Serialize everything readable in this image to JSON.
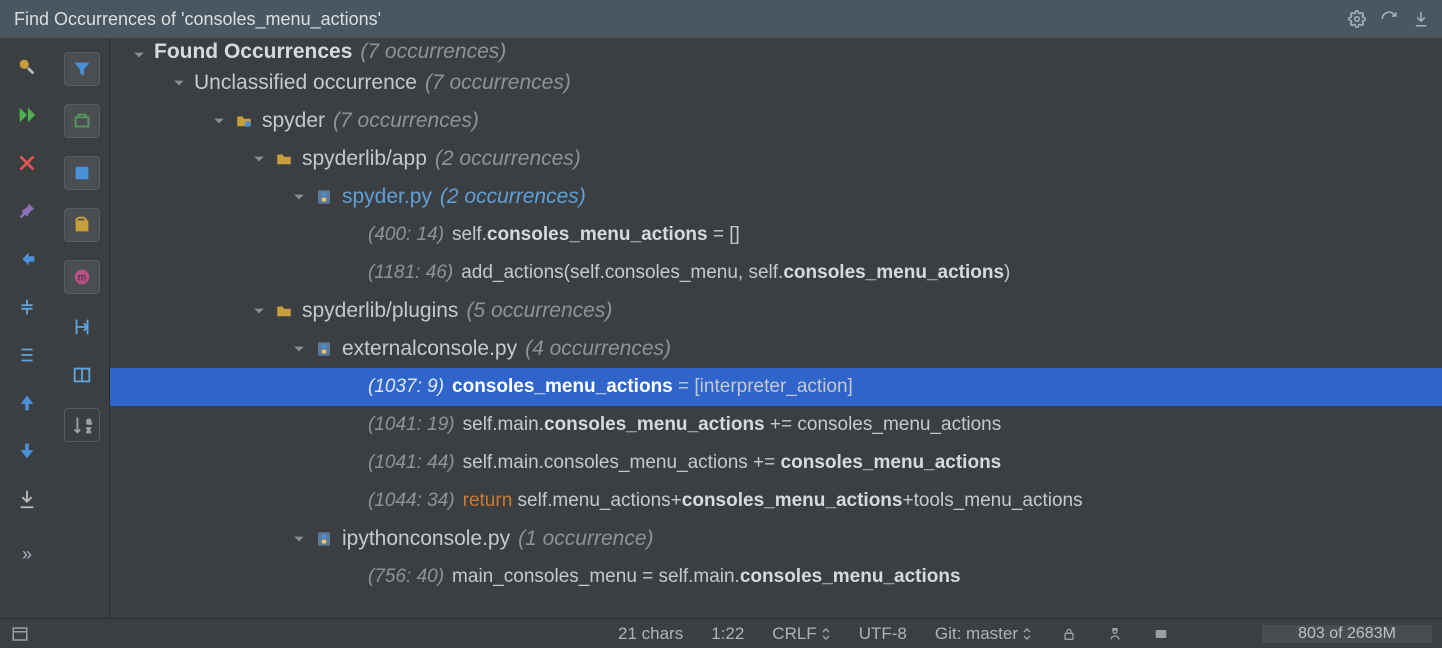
{
  "title": "Find Occurrences of 'consoles_menu_actions'",
  "tree": {
    "root_label": "Found Occurrences",
    "root_count": "(7 occurrences)",
    "unclassified_label": "Unclassified occurrence",
    "unclassified_count": "(7 occurrences)",
    "proj_label": "spyder",
    "proj_count": "(7 occurrences)",
    "dir1_label": "spyderlib/app",
    "dir1_count": "(2 occurrences)",
    "file1_label": "spyder.py",
    "file1_count": "(2 occurrences)",
    "f1l1_loc": "(400: 14)",
    "f1l1_pre": "self.",
    "f1l1_hit": "consoles_menu_actions",
    "f1l1_post": " = []",
    "f1l2_loc": "(1181: 46)",
    "f1l2_pre": "add_actions(self.consoles_menu, self.",
    "f1l2_hit": "consoles_menu_actions",
    "f1l2_post": ")",
    "dir2_label": "spyderlib/plugins",
    "dir2_count": "(5 occurrences)",
    "file2_label": "externalconsole.py",
    "file2_count": "(4 occurrences)",
    "f2l1_loc": "(1037: 9)",
    "f2l1_hit": "consoles_menu_actions",
    "f2l1_post": " = [interpreter_action]",
    "f2l2_loc": "(1041: 19)",
    "f2l2_pre": "self.main.",
    "f2l2_hit": "consoles_menu_actions",
    "f2l2_post": " += consoles_menu_actions",
    "f2l3_loc": "(1041: 44)",
    "f2l3_pre": "self.main.consoles_menu_actions += ",
    "f2l3_hit": "consoles_menu_actions",
    "f2l4_loc": "(1044: 34)",
    "f2l4_kw": "return",
    "f2l4_pre": " self.menu_actions+",
    "f2l4_hit": "consoles_menu_actions",
    "f2l4_post": "+tools_menu_actions",
    "file3_label": "ipythonconsole.py",
    "file3_count": "(1 occurrence)",
    "f3l1_loc": "(756: 40)",
    "f3l1_pre": "main_consoles_menu = self.main.",
    "f3l1_hit": "consoles_menu_actions"
  },
  "status": {
    "chars": "21 chars",
    "pos": "1:22",
    "eol": "CRLF",
    "enc": "UTF-8",
    "git": "Git: master",
    "mem": "803 of 2683M"
  }
}
